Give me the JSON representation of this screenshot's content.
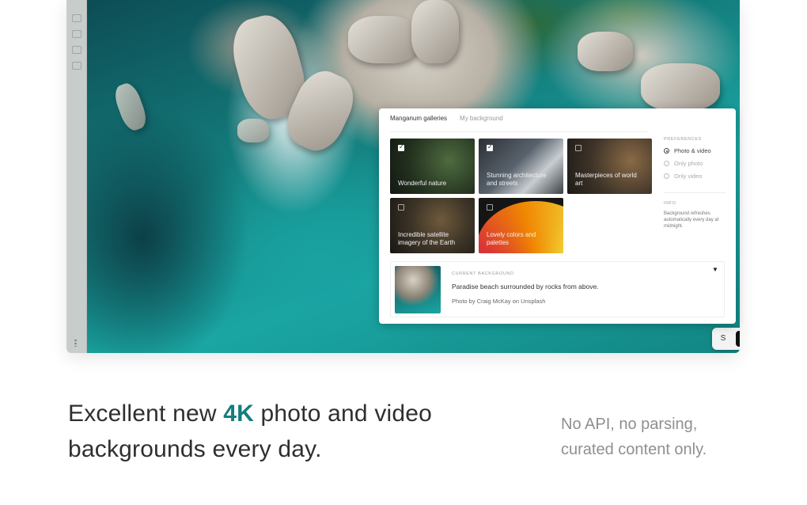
{
  "panel": {
    "tabs": [
      {
        "label": "Manganum galleries",
        "active": true
      },
      {
        "label": "My background",
        "active": false
      }
    ],
    "tiles": [
      {
        "label": "Wonderful nature",
        "checked": true
      },
      {
        "label": "Stunning architecture and streets",
        "checked": true
      },
      {
        "label": "Masterpieces of world art",
        "checked": false
      },
      {
        "label": "Incredible satellite imagery of the Earth",
        "checked": false
      },
      {
        "label": "Lovely colors and palettes",
        "checked": false
      }
    ],
    "preferences": {
      "caption": "PREFERENCES",
      "options": [
        {
          "label": "Photo & video",
          "selected": true
        },
        {
          "label": "Only photo",
          "selected": false
        },
        {
          "label": "Only video",
          "selected": false
        }
      ]
    },
    "info": {
      "caption": "INFO",
      "text": "Background refreshes automatically every day at midnight."
    },
    "current": {
      "caption": "CURRENT BACKGROUND",
      "description": "Paradise beach surrounded by rocks from above.",
      "credit_prefix": "Photo by",
      "author": "Craig McKay",
      "credit_middle": "on",
      "source": "Unsplash"
    }
  },
  "icons": {
    "download": "download-icon",
    "toggle_left": "s-icon",
    "toggle_right": "frame-icon"
  },
  "marketing": {
    "headline_before": "Excellent new ",
    "headline_highlight": "4K",
    "headline_after": " photo and video backgrounds every day.",
    "tagline": "No API, no parsing, curated content only."
  },
  "colors": {
    "accent": "#147e7c",
    "headline": "#2f2f2f",
    "tagline": "#8f8f8f"
  }
}
